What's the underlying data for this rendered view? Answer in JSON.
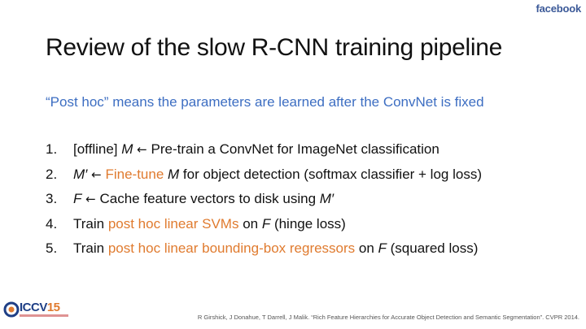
{
  "brand": "facebook",
  "title": "Review of the slow R-CNN training pipeline",
  "subtitle": "“Post hoc” means the parameters are learned after the ConvNet is fixed",
  "steps": [
    {
      "num": "1.",
      "a": "[offline] ",
      "v1": "M",
      "arrow": " ← ",
      "b": "Pre-train a ConvNet for ImageNet classification"
    },
    {
      "num": "2.",
      "v1": "M′",
      "arrow": " ← ",
      "hl": "Fine-tune",
      "v2": " M",
      "b": " for object detection (softmax classifier + log loss)"
    },
    {
      "num": "3.",
      "v1": "F",
      "arrow": " ← ",
      "b": "Cache feature vectors to disk using ",
      "v2": "M′"
    },
    {
      "num": "4.",
      "a": "Train ",
      "hl": "post hoc linear SVMs",
      "b": " on ",
      "v1": "F",
      "c": " (hinge loss)"
    },
    {
      "num": "5.",
      "a": "Train ",
      "hl": "post hoc linear bounding-box regressors",
      "b": " on ",
      "v1": "F",
      "c": " (squared loss)"
    }
  ],
  "logo": {
    "text": "ICCV",
    "year": "15"
  },
  "citation": "R Girshick, J Donahue, T Darrell, J Malik. “Rich Feature Hierarchies for Accurate Object Detection and Semantic Segmentation”. CVPR 2014.",
  "colors": {
    "highlight": "#e07b2f",
    "subtitle": "#3d6ec2",
    "brand": "#3b5998"
  }
}
